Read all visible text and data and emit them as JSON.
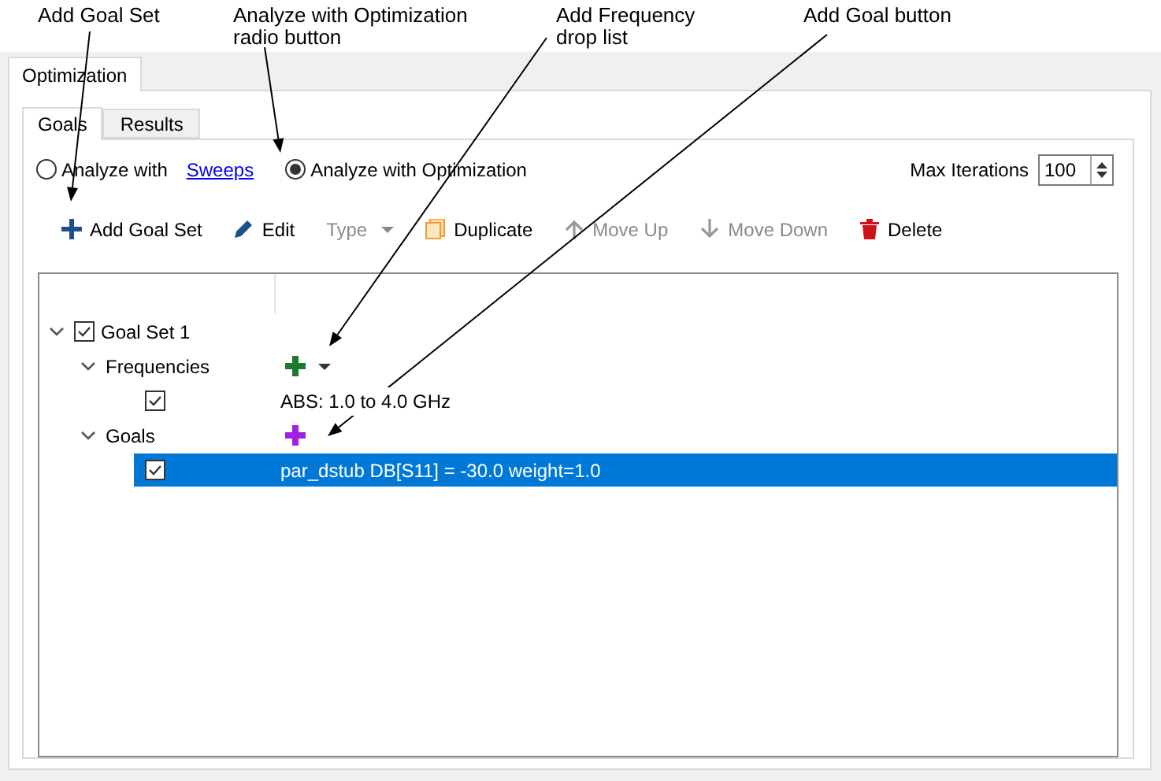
{
  "callouts": [
    {
      "text": "Add Goal Set"
    },
    {
      "text": "Analyze with Optimization radio button"
    },
    {
      "text": "Add Frequency drop list"
    },
    {
      "text": "Add Goal button"
    }
  ],
  "outer_tabs": [
    {
      "label": "Optimization",
      "selected": true
    }
  ],
  "inner_tabs": [
    {
      "label": "Goals",
      "selected": true
    },
    {
      "label": "Results",
      "selected": false
    }
  ],
  "analyze_options": [
    {
      "label": "Analyze with",
      "link": "Sweeps",
      "selected": false
    },
    {
      "label": "Analyze with Optimization",
      "selected": true
    }
  ],
  "max_iterations": {
    "label": "Max Iterations",
    "value": "100"
  },
  "toolbar": [
    {
      "kind": "add",
      "label": "Add Goal Set",
      "disabled": false
    },
    {
      "kind": "edit",
      "label": "Edit",
      "disabled": false
    },
    {
      "kind": "type",
      "label": "Type",
      "disabled": true
    },
    {
      "kind": "duplicate",
      "label": "Duplicate",
      "disabled": false
    },
    {
      "kind": "up",
      "label": "Move Up",
      "disabled": true
    },
    {
      "kind": "down",
      "label": "Move Down",
      "disabled": true
    },
    {
      "kind": "delete",
      "label": "Delete",
      "disabled": false
    }
  ],
  "tree": [
    {
      "kind": "set",
      "label": "Goal Set 1",
      "checked": true,
      "expanded": true,
      "children": [
        {
          "kind": "group",
          "label": "Frequencies",
          "expanded": true,
          "color": "#1b7a2e",
          "dropdown": true,
          "children": [
            {
              "kind": "item",
              "checked": true,
              "selected": false,
              "value": "ABS: 1.0 to 4.0 GHz"
            }
          ]
        },
        {
          "kind": "group",
          "label": "Goals",
          "expanded": true,
          "color": "#a020e0",
          "children": [
            {
              "kind": "item",
              "checked": true,
              "selected": true,
              "value": "par_dstub DB[S11] = -30.0 weight=1.0"
            }
          ]
        }
      ]
    }
  ]
}
